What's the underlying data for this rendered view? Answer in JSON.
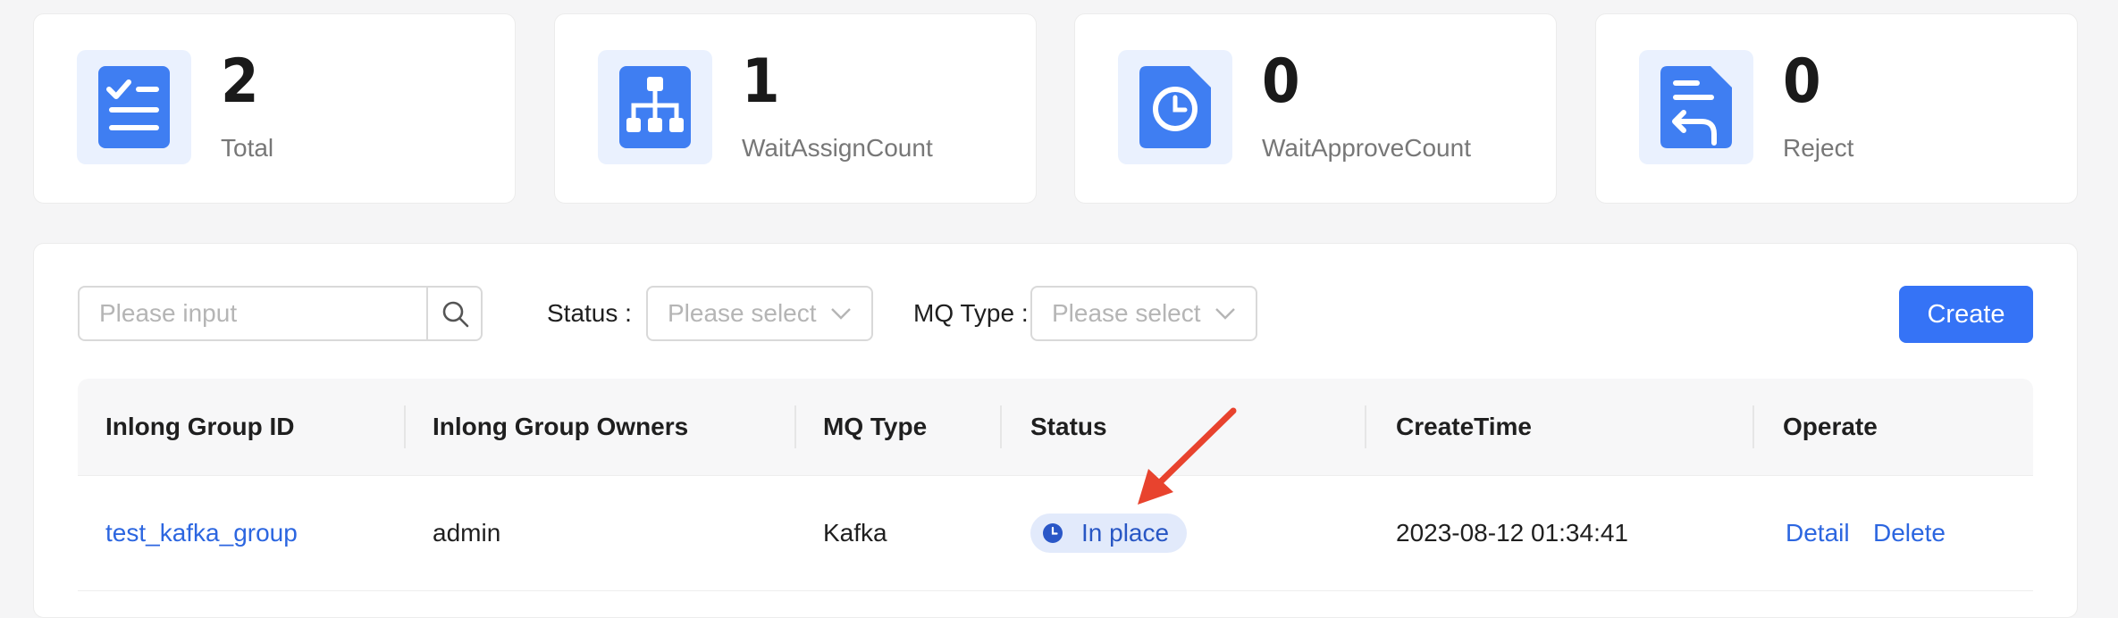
{
  "stats": [
    {
      "value": "2",
      "label": "Total",
      "icon": "checklist-icon"
    },
    {
      "value": "1",
      "label": "WaitAssignCount",
      "icon": "org-chart-icon"
    },
    {
      "value": "0",
      "label": "WaitApproveCount",
      "icon": "clock-document-icon"
    },
    {
      "value": "0",
      "label": "Reject",
      "icon": "return-document-icon"
    }
  ],
  "toolbar": {
    "search_placeholder": "Please input",
    "status_label": "Status",
    "status_placeholder": "Please select",
    "mq_label": "MQ Type",
    "mq_placeholder": "Please select",
    "create_label": "Create"
  },
  "table": {
    "columns": [
      "Inlong Group ID",
      "Inlong Group Owners",
      "MQ Type",
      "Status",
      "CreateTime",
      "Operate"
    ],
    "rows": [
      {
        "group_id": "test_kafka_group",
        "owners": "admin",
        "mq_type": "Kafka",
        "status": "In place",
        "create_time": "2023-08-12 01:34:41",
        "actions": {
          "detail": "Detail",
          "delete": "Delete"
        }
      }
    ]
  },
  "colors": {
    "accent": "#3573f6",
    "icon_bg": "#eaf1fe",
    "link": "#2c66e0",
    "status_bg": "#e2eafb",
    "annotation_arrow": "#e8432e"
  }
}
